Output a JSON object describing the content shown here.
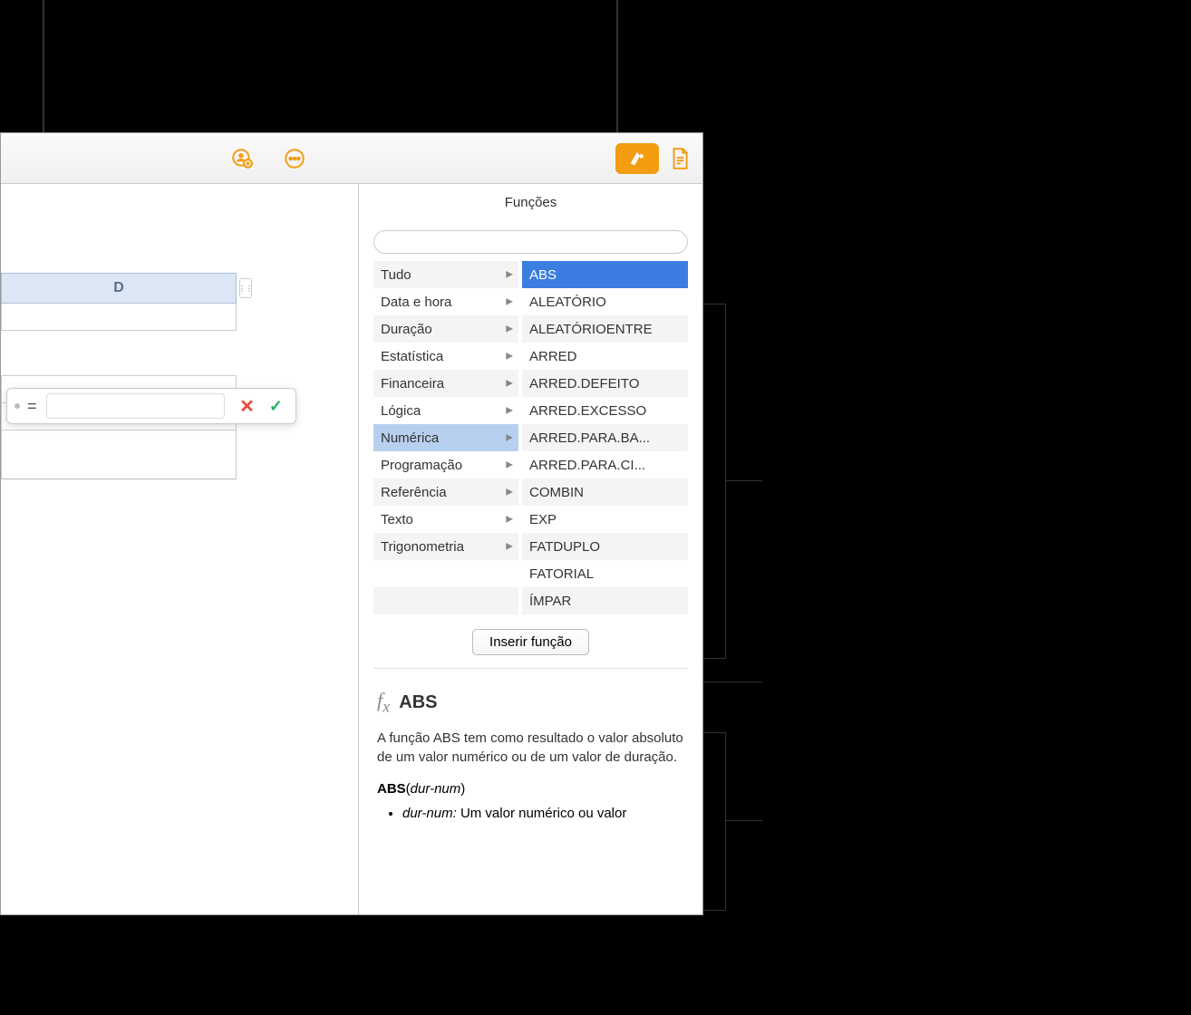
{
  "sidebar": {
    "title": "Funções",
    "search_placeholder": "",
    "categories": [
      {
        "label": "Tudo",
        "selected": false
      },
      {
        "label": "Data e hora",
        "selected": false
      },
      {
        "label": "Duração",
        "selected": false
      },
      {
        "label": "Estatística",
        "selected": false
      },
      {
        "label": "Financeira",
        "selected": false
      },
      {
        "label": "Lógica",
        "selected": false
      },
      {
        "label": "Numérica",
        "selected": true
      },
      {
        "label": "Programação",
        "selected": false
      },
      {
        "label": "Referência",
        "selected": false
      },
      {
        "label": "Texto",
        "selected": false
      },
      {
        "label": "Trigonometria",
        "selected": false
      }
    ],
    "functions": [
      {
        "label": "ABS",
        "selected": true
      },
      {
        "label": "ALEATÓRIO",
        "selected": false
      },
      {
        "label": "ALEATÓRIOENTRE",
        "selected": false
      },
      {
        "label": "ARRED",
        "selected": false
      },
      {
        "label": "ARRED.DEFEITO",
        "selected": false
      },
      {
        "label": "ARRED.EXCESSO",
        "selected": false
      },
      {
        "label": "ARRED.PARA.BA...",
        "selected": false
      },
      {
        "label": "ARRED.PARA.CI...",
        "selected": false
      },
      {
        "label": "COMBIN",
        "selected": false
      },
      {
        "label": "EXP",
        "selected": false
      },
      {
        "label": "FATDUPLO",
        "selected": false
      },
      {
        "label": "FATORIAL",
        "selected": false
      },
      {
        "label": "ÍMPAR",
        "selected": false
      }
    ],
    "insert_button": "Inserir função",
    "help": {
      "title": "ABS",
      "description": "A função ABS tem como resultado o valor absoluto de um valor numérico ou de um valor de duração.",
      "syntax_name": "ABS",
      "syntax_param": "dur-num",
      "param_name": "dur-num:",
      "param_desc": "Um valor numérico ou valor"
    }
  },
  "spreadsheet": {
    "column_label": "D"
  },
  "formula_editor": {
    "equals": "=",
    "value": ""
  },
  "colors": {
    "accent": "#f39c12",
    "selected": "#3b7de0",
    "selected_cat": "#b8d0f0"
  }
}
